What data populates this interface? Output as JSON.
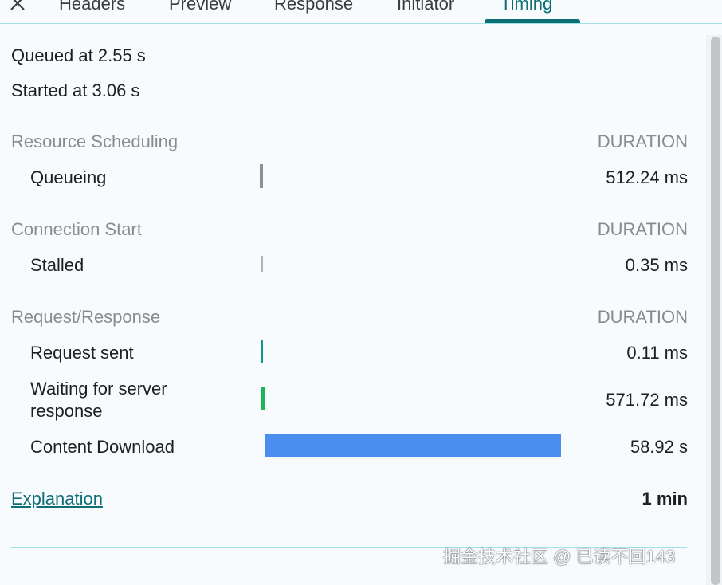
{
  "tabs": [
    {
      "label": "Headers"
    },
    {
      "label": "Preview"
    },
    {
      "label": "Response"
    },
    {
      "label": "Initiator"
    },
    {
      "label": "Timing"
    }
  ],
  "summary": {
    "queued": "Queued at 2.55 s",
    "started": "Started at 3.06 s"
  },
  "sections": {
    "resource_scheduling": {
      "title": "Resource Scheduling",
      "duration_header": "DURATION",
      "rows": [
        {
          "label": "Queueing",
          "value": "512.24 ms"
        }
      ]
    },
    "connection_start": {
      "title": "Connection Start",
      "duration_header": "DURATION",
      "rows": [
        {
          "label": "Stalled",
          "value": "0.35 ms"
        }
      ]
    },
    "request_response": {
      "title": "Request/Response",
      "duration_header": "DURATION",
      "rows": [
        {
          "label": "Request sent",
          "value": "0.11 ms"
        },
        {
          "label_line1": "Waiting for server",
          "label_line2": "response",
          "value": "571.72 ms"
        },
        {
          "label": "Content Download",
          "value": "58.92 s"
        }
      ]
    }
  },
  "footer": {
    "explanation": "Explanation",
    "total": "1 min"
  },
  "watermark": "掘金技术社区 @ 已读不回143",
  "colors": {
    "accent": "#0e6e75",
    "queueing_bar": "#8e8e8e",
    "stalled_bar": "#b0b0b0",
    "request_sent_bar": "#13968f",
    "waiting_bar": "#1fb35a",
    "download_bar": "#4a8ef0"
  }
}
